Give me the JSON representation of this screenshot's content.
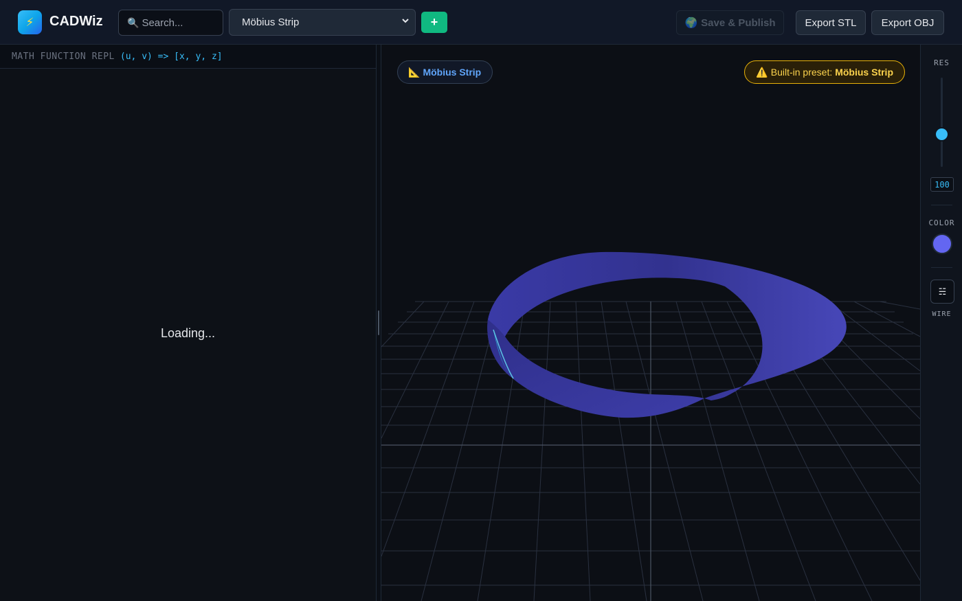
{
  "header": {
    "app_title": "CADWiz",
    "logo_icon": "lightning-icon",
    "search_placeholder": "Search...",
    "preset_selected": "Möbius Strip",
    "add_label": "+",
    "publish_label": "Save & Publish",
    "export_stl_label": "Export STL",
    "export_obj_label": "Export OBJ"
  },
  "repl": {
    "label": "MATH FUNCTION REPL",
    "signature": "(u, v) => [x, y, z]",
    "loading_text": "Loading..."
  },
  "viewport": {
    "shape_name": "Möbius Strip",
    "preset_prefix": "Built-in preset:",
    "preset_name": "Möbius Strip",
    "surface_color": "#3f3fae"
  },
  "rail": {
    "res_label": "RES",
    "res_value": "100",
    "color_label": "COLOR",
    "color_value": "#6366f1",
    "wire_label": "WIRE"
  },
  "colors": {
    "accent": "#38bdf8",
    "add_button": "#10b981",
    "warning": "#eab308"
  }
}
